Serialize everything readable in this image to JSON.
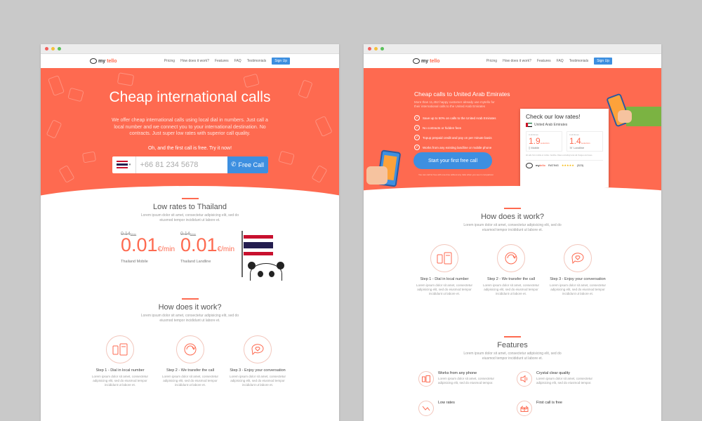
{
  "colors": {
    "accent": "#fe6a50",
    "primary_button": "#3d8fe0",
    "backdrop": "#c9c9c9"
  },
  "nav": {
    "logo_prefix": "my",
    "logo_suffix": "tello",
    "links": [
      "Pricing",
      "How does it work?",
      "Features",
      "FAQ",
      "Testimonials"
    ],
    "signup": "Sign Up"
  },
  "left": {
    "hero": {
      "title": "Cheap international calls",
      "subtitle": "We offer cheap international calls using local dial in numbers. Just call a local number and we connect you to your international destination. No contracts. Just super low rates with superior call quality.",
      "free_note": "Oh, and the first call is free. Try it now!",
      "phone_placeholder": "+66 81 234 5678",
      "call_button": "Free Call"
    },
    "rates": {
      "title": "Low rates to Thailand",
      "desc": "Lorem ipsum dolor sit amet, consectetur adipisicing elit, sed do eiusmod tempor incididunt ut labore et.",
      "items": [
        {
          "old": "0.14",
          "old_unit": "€/min",
          "value": "0.01",
          "unit": "€/min",
          "label": "Thailand Mobile"
        },
        {
          "old": "0.14",
          "old_unit": "€/min",
          "value": "0.01",
          "unit": "€/min",
          "label": "Thailand Landline"
        }
      ]
    },
    "how": {
      "title": "How does it work?",
      "desc": "Lorem ipsum dolor sit amet, consectetur adipisicing elit, sed do eiusmod tempor incididunt ut labore et.",
      "steps": [
        {
          "title": "Step 1 - Dial in local number",
          "desc": "Lorem ipsum dolor sit amet, consectetur adipisicing elit, sed do eiusmod tempor incididunt ut labore et."
        },
        {
          "title": "Step 2 - We transfer the call",
          "desc": "Lorem ipsum dolor sit amet, consectetur adipisicing elit, sed do eiusmod tempor incididunt ut labore et."
        },
        {
          "title": "Step 3 - Enjoy your conversation",
          "desc": "Lorem ipsum dolor sit amet, consectetur adipisicing elit, sed do eiusmod tempor incididunt ut labore et."
        }
      ]
    }
  },
  "right": {
    "hero": {
      "title": "Cheap calls to United Arab Emirates",
      "subtitle": "More than 11,452 happy customer already use mytello for their international calls to the United Arab Emirates",
      "checks": [
        "Save up to 50% on calls to the United Arab Emirates",
        "No contracts or hidden fees",
        "Topup prepaid credit and pay on per minute basis",
        "Works from any existing landline or mobile phone"
      ],
      "cta": "Start your first free call",
      "fine_print": "You can call for free with one-time without any risks when you see in comparison"
    },
    "card": {
      "title": "Check our low rates!",
      "country": "United Arab Emirates",
      "rates": [
        {
          "old": "0.19 €/min",
          "value": "1.9",
          "unit": "cents/min",
          "label": "Mobile"
        },
        {
          "old": "0.19 €/min",
          "value": "1.4",
          "unit": "cents/min",
          "label": "Landline"
        }
      ],
      "note": "All calls from mobile to mobile / landline. Rates excluding local call charges and taxes.",
      "rating_label": "RATING",
      "stars": "★★★★★",
      "rating_count": "(323)"
    },
    "how": {
      "title": "How does it work?",
      "desc": "Lorem ipsum dolor sit amet, consectetur adipisicing elit, sed do eiusmod tempor incididunt ut labore et.",
      "steps": [
        {
          "title": "Step 1 - Dial in local number",
          "desc": "Lorem ipsum dolor sit amet, consectetur adipisicing elit, sed do eiusmod tempor incididunt ut labore et."
        },
        {
          "title": "Step 2 - We transfer the call",
          "desc": "Lorem ipsum dolor sit amet, consectetur adipisicing elit, sed do eiusmod tempor incididunt ut labore et."
        },
        {
          "title": "Step 3 - Enjoy your conversation",
          "desc": "Lorem ipsum dolor sit amet, consectetur adipisicing elit, sed do eiusmod tempor incididunt ut labore et."
        }
      ]
    },
    "features": {
      "title": "Features",
      "desc": "Lorem ipsum dolor sit amet, consectetur adipisicing elit, sed do eiusmod tempor incididunt ut labore et.",
      "items": [
        {
          "title": "Works from any phone",
          "desc": "Lorem ipsum dolor sit amet, consectetur adipisicing elit, sed do eiusmod tempor."
        },
        {
          "title": "Crystal clear quality",
          "desc": "Lorem ipsum dolor sit amet, consectetur adipisicing elit, sed do eiusmod tempor."
        },
        {
          "title": "Low rates",
          "desc": ""
        },
        {
          "title": "First call is free",
          "desc": ""
        }
      ]
    }
  }
}
